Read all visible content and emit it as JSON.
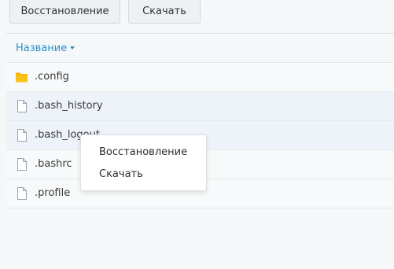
{
  "toolbar": {
    "restore_label": "Восстановление",
    "download_label": "Скачать"
  },
  "list": {
    "header": {
      "sort_label": "Название",
      "sort_direction": "descending"
    },
    "items": [
      {
        "name": ".config",
        "type": "folder"
      },
      {
        "name": ".bash_history",
        "type": "file"
      },
      {
        "name": ".bash_logout",
        "type": "file"
      },
      {
        "name": ".bashrc",
        "type": "file"
      },
      {
        "name": ".profile",
        "type": "file"
      }
    ]
  },
  "context_menu": {
    "items": [
      {
        "label": "Восстановление"
      },
      {
        "label": "Скачать"
      }
    ]
  },
  "colors": {
    "accent": "#2b8fc9",
    "folder": "#f5b400",
    "row_highlight": "#edf3f9"
  }
}
